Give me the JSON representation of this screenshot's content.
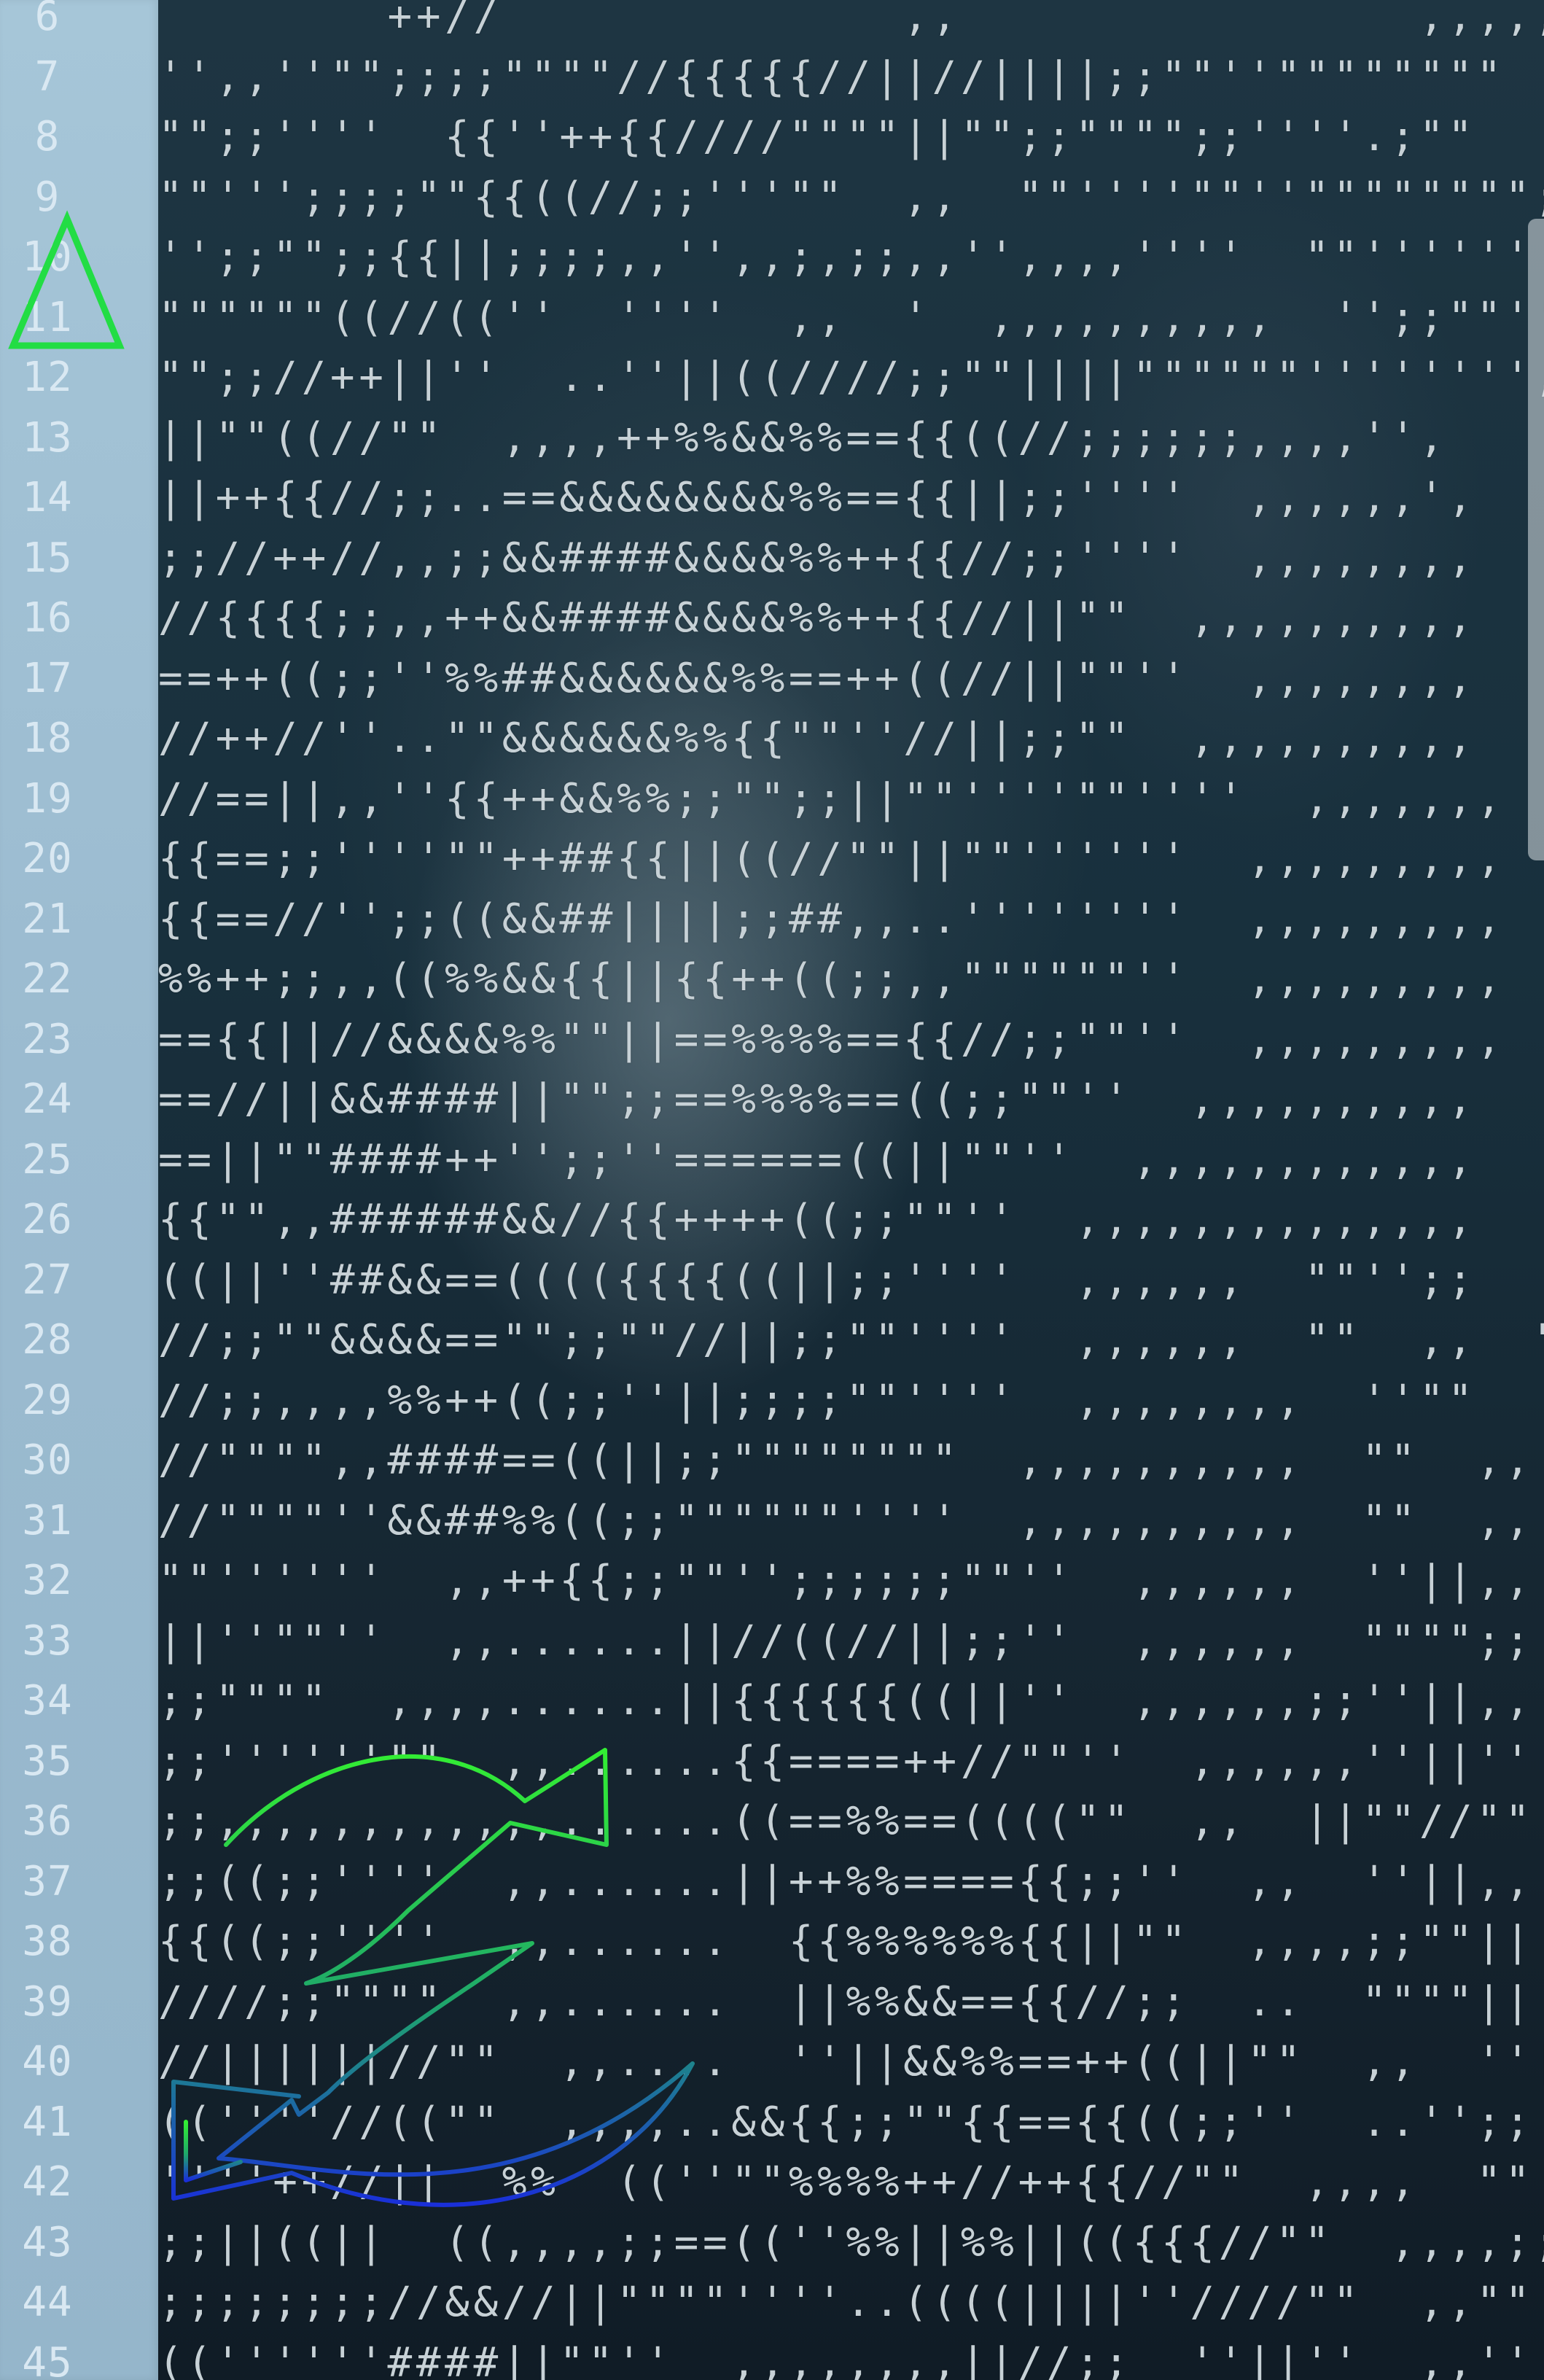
{
  "editor": {
    "first_line_number": 6,
    "line_numbers": [
      "6",
      "7",
      "8",
      "9",
      "10",
      "11",
      "12",
      "13",
      "14",
      "15",
      "16",
      "17",
      "18",
      "19",
      "20",
      "21",
      "22",
      "23",
      "24",
      "25",
      "26",
      "27",
      "28",
      "29",
      "30",
      "31",
      "32",
      "33",
      "34",
      "35",
      "36",
      "37",
      "38",
      "39",
      "40",
      "41",
      "42",
      "43",
      "44",
      "45"
    ],
    "lines": [
      "        ++//              ,,                ,,,,,,",
      "'',,''\"\";;;;\"\"\"\"//{{{{{//||//||||;;\"\"''\"\"\"\"\"\"\"\"",
      "\"\";;''''  {{''++{{////\"\"\"\"||\"\";;\"\"\"\";;''''.;\"\"",
      "\"\"''';;;;\"\"{{((//;;'''\"\"  ,,  \"\"''''\"\"''\"\"\"\"\"\"\"\";;",
      "'';;\"\";;{{||;;;;,,'',,;,;;,,'',,,,''''  \"\"''''''",
      "\"\"\"\"\"\"((//((''  ''''  ,,  '  ,,,,,,,,,,  '';;\"\"''''",
      "\"\";;//++||''  ..''||((////;;\"\"||||\"\"\"\"\"\"'''''''',",
      "||\"\"((//\"\"  ,,,,++%%&&%%=={{((//;;;;;;,,,,'',",
      "||++{{//;;..==&&&&&&&&%%=={{||;;''''  ,,,,,,',",
      ";;//++//,,;;&&####&&&&%%++{{//;;''''  ,,,,,,,,",
      "//{{{{;;,,++&&####&&&&%%++{{//||\"\"  ,,,,,,,,,,",
      "==++((;;''%%##&&&&&&%%==++((//||\"\"''  ,,,,,,,,",
      "//++//''..\"\"&&&&&&%%{{\"\"''//||;;\"\"  ,,,,,,,,,,",
      "//==||,,''{{++&&%%;;\"\";;||\"\"''''\"\"''''  ,,,,,,,",
      "{{==;;''''\"\"++##{{||((//\"\"||\"\"''''''  ,,,,,,,,,",
      "{{==//'';;((&&##||||;;##,,..''''''''  ,,,,,,,,,",
      "%%++;;,,((%%&&{{||{{++((;;,,\"\"\"\"\"\"''  ,,,,,,,,,",
      "=={{||//&&&&%%\"\"||==%%%%=={{//;;\"\"''  ,,,,,,,,,",
      "==//||&&####||\"\";;==%%%%==((;;\"\"''  ,,,,,,,,,,",
      "==||\"\"####++'';;''======((||\"\"''  ,,,,,,,,,,,,",
      "{{\"\",,######&&//{{++++((;;\"\"''  ,,,,,,,,,,,,,,",
      "((||''##&&==(((({{{{((||;;''''  ,,,,,,  \"\"'';;",
      "//;;\"\"&&&&==\"\";;\"\"//||;;\"\"''''  ,,,,,,  \"\"  ,,  \"\"",
      "//;;,,,,%%++((;;''||;;;;\"\"''''  ,,,,,,,,  ''\"\"",
      "//\"\"\"\",,####==((||;;\"\"\"\"\"\"\"\"  ,,,,,,,,,,  \"\"  ,,",
      "//\"\"\"\"''&&##%%((;;\"\"\"\"\"\"''''  ,,,,,,,,,,  \"\"  ,,",
      "\"\"''''''  ,,++{{;;\"\"'';;;;;;\"\"''  ,,,,,,  ''||,,",
      "||''\"\"''  ,,......||//((//||;;''  ,,,,,,  \"\"\"\";;",
      ";;\"\"\"\"  ,,,,......||{{{{{{((||''  ,,,,,,;;''||,,",
      ";;''''''\"\"  ,,......{{====++//\"\"''  ,,,,,,''||''",
      ";;,,,,,,,,,,,,......((==%%==((((\"\"  ,,  ||\"\"//\"\"",
      ";;((;;''''  ,,......||++%%===={{;;''  ,,  ''||,,",
      "{{((;;''''  ,,......  {{%%%%%%{{||\"\"  ,,,,;;\"\"||",
      "////;;\"\"\"\"  ,,......  ||%%&&=={{//;;  ..  \"\"\"\"||",
      "//||||||//\"\"  ,,....  ''||&&%%==++((||\"\"  ,,  ''||",
      "((''''//((\"\"  ,,,,..&&{{;;\"\"{{=={{((;;''  ..'';;",
      "''''++//||  %%  ((''\"\"%%%%++//++{{//\"\"  ,,,,  \"\"",
      ";;||((||  ((,,,,;;==((''%%||%%||(({{{//\"\"  ,,,,;;",
      ";;;;;;;;//&&//||\"\"\"\"''''..((((||||''////\"\"  ,,\"\"",
      "((''''''####||\"\"''  ,,,,,,,,||//;;  ''||''  ,,''"
    ]
  },
  "colors": {
    "gutter_bg": "#9bbbd0",
    "gutter_text": "#d9e8f2",
    "editor_bg": "#18303d",
    "code_text": "#c7d1d6",
    "triangle_marker": "#22dd44",
    "z_gradient_top": "#33ee33",
    "z_gradient_bottom": "#1a2fd8"
  },
  "icons": {
    "line_marker": "triangle-icon",
    "overlay_drawing": "z-arrow-icon"
  }
}
